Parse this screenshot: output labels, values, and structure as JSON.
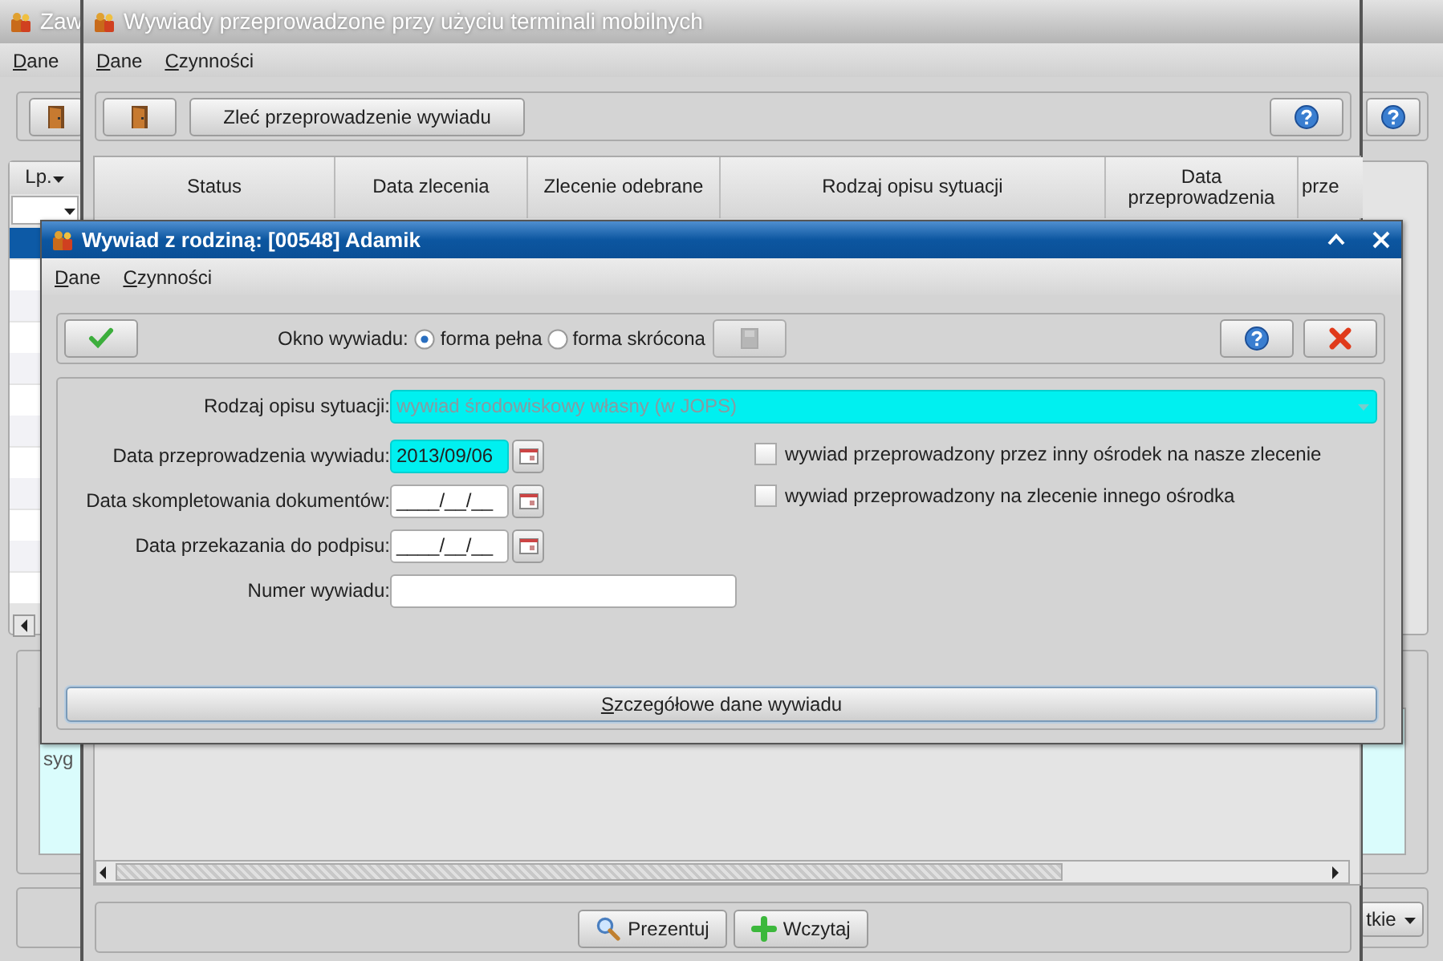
{
  "back_window": {
    "title": "Zaw",
    "menu": [
      "Dane"
    ],
    "column_header": "Lp.",
    "rows": [
      {
        "selected": true
      },
      {
        "selected": false
      },
      {
        "selected": false
      },
      {
        "selected": false
      },
      {
        "selected": false
      },
      {
        "selected": false
      },
      {
        "selected": false
      },
      {
        "selected": false
      },
      {
        "selected": false
      },
      {
        "selected": false
      },
      {
        "selected": false
      },
      {
        "selected": false
      }
    ],
    "side_text": "syg",
    "bottom_button": "tkie"
  },
  "main_window": {
    "title": "Wywiady przeprowadzone przy użyciu terminali mobilnych",
    "menu": [
      "Dane",
      "Czynności"
    ],
    "order_button": "Zleć przeprowadzenie wywiadu",
    "columns": [
      "Status",
      "Data zlecenia",
      "Zlecenie odebrane",
      "Rodzaj opisu sytuacji",
      "Data przeprowadzenia",
      "prze"
    ],
    "buttons": [
      {
        "kind": "search",
        "label": "Prezentuj"
      },
      {
        "kind": "add",
        "label": "Wczytaj"
      }
    ]
  },
  "dialog": {
    "title": "Wywiad z rodziną: [00548] Adamik",
    "menu": [
      "Dane",
      "Czynności"
    ],
    "view_label": "Okno wywiadu:",
    "view_options": [
      {
        "label": "forma pełna",
        "selected": true
      },
      {
        "label": "forma skrócona",
        "selected": false
      }
    ],
    "type_field": {
      "label": "Rodzaj opisu sytuacji:",
      "value": "wywiad środowiskowy własny (w JOPS)",
      "required": true
    },
    "fields": [
      {
        "kind": "date",
        "label": "Data przeprowadzenia wywiadu:",
        "value": "2013/09/06",
        "required": true
      },
      {
        "kind": "date",
        "label": "Data skompletowania dokumentów:",
        "value": "____/__/__",
        "required": false
      },
      {
        "kind": "date",
        "label": "Data przekazania do podpisu:",
        "value": "____/__/__",
        "required": false
      },
      {
        "kind": "text",
        "label": "Numer wywiadu:",
        "required": false
      }
    ],
    "checkboxes": [
      {
        "label": "wywiad przeprowadzony przez inny ośrodek na nasze zlecenie",
        "checked": false
      },
      {
        "label": "wywiad przeprowadzony na zlecenie innego ośrodka",
        "checked": false
      }
    ],
    "details_button": "Szczegółowe dane wywiadu"
  }
}
